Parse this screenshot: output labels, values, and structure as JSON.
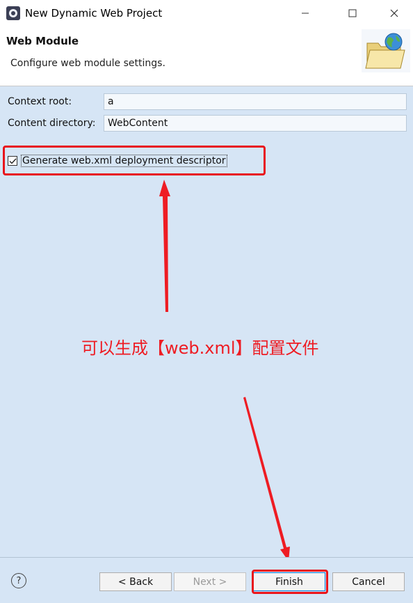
{
  "window": {
    "title": "New Dynamic Web Project",
    "icon": "eclipse-icon"
  },
  "banner": {
    "title": "Web Module",
    "description": "Configure web module settings.",
    "image": "folder-globe-icon"
  },
  "form": {
    "context_root_label": "Context root:",
    "context_root_value": "a",
    "content_directory_label": "Content directory:",
    "content_directory_value": "WebContent",
    "generate_descriptor_label": "Generate web.xml deployment descriptor",
    "generate_descriptor_checked": true
  },
  "annotation": {
    "text": "可以生成【web.xml】配置文件",
    "color": "#ee1c23"
  },
  "buttons": {
    "back": "< Back",
    "next": "Next >",
    "finish": "Finish",
    "cancel": "Cancel"
  },
  "colors": {
    "panel_background": "#d6e5f5",
    "highlight": "#e8141b"
  }
}
